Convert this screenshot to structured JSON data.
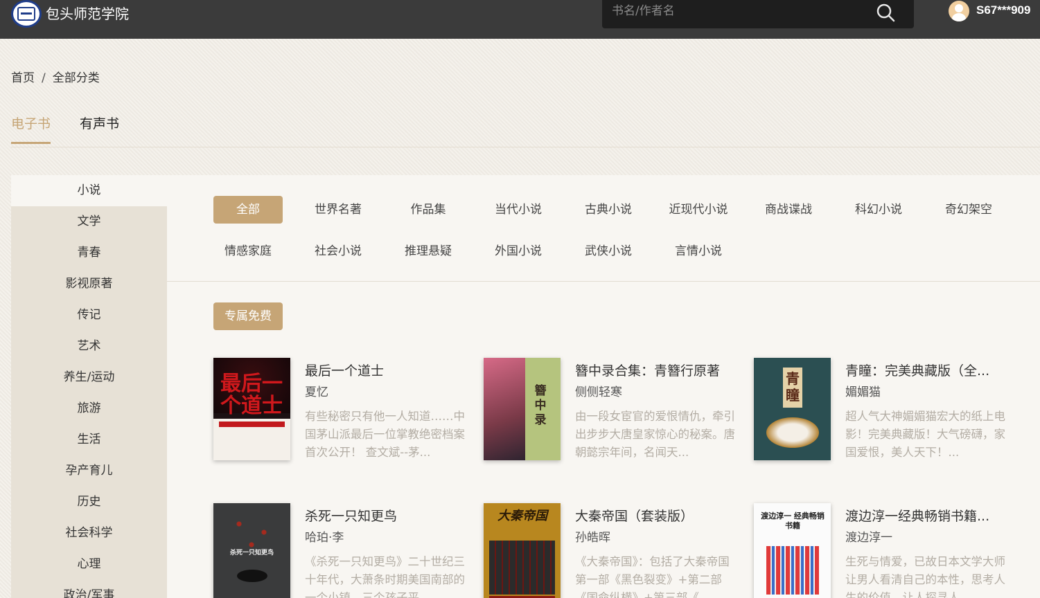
{
  "header": {
    "site_name": "包头师范学院",
    "search_placeholder": "书名/作者名",
    "username": "S67***909"
  },
  "breadcrumb": {
    "home": "首页",
    "separator": "/",
    "current": "全部分类"
  },
  "type_tabs": [
    "电子书",
    "有声书"
  ],
  "sidebar": [
    "小说",
    "文学",
    "青春",
    "影视原著",
    "传记",
    "艺术",
    "养生/运动",
    "旅游",
    "生活",
    "孕产育儿",
    "历史",
    "社会科学",
    "心理",
    "政治/军事"
  ],
  "sub_categories": [
    "全部",
    "世界名著",
    "作品集",
    "当代小说",
    "古典小说",
    "近现代小说",
    "商战谍战",
    "科幻小说",
    "奇幻架空",
    "情感家庭",
    "社会小说",
    "推理悬疑",
    "外国小说",
    "武侠小说",
    "言情小说"
  ],
  "free_button": "专属免费",
  "books": [
    {
      "title": "最后一个道士",
      "author": "夏忆",
      "desc": "有些秘密只有他一人知道……中国茅山派最后一位掌教绝密档案首次公开！ 查文斌--茅...",
      "cover_text": "最后一个道士"
    },
    {
      "title": "簪中录合集：青簪行原著",
      "author": "侧侧轻寒",
      "desc": "由一段女宦官的爱恨情仇，牵引出步步大唐皇家惊心的秘案。唐朝懿宗年间，名闻天...",
      "cover_text": "簪中录"
    },
    {
      "title": "青瞳：完美典藏版（全...",
      "author": "媚媚猫",
      "desc": "超人气大神媚媚猫宏大的纸上电影！完美典藏版！大气磅礴，家国爱恨，美人天下！...",
      "cover_text": "青瞳"
    },
    {
      "title": "杀死一只知更鸟",
      "author": "哈珀·李",
      "desc": "《杀死一只知更鸟》二十世纪三十年代，大萧条时期美国南部的一个小镇，三个孩子平...",
      "cover_text": "杀死一只知更鸟"
    },
    {
      "title": "大秦帝国（套装版）",
      "author": "孙皓晖",
      "desc": "《大秦帝国》：包括了大秦帝国第一部《黑色裂变》+第二部《国命纵横》+第三部《...",
      "cover_text": "大秦帝国"
    },
    {
      "title": "渡边淳一经典畅销书籍...",
      "author": "渡边淳一",
      "desc": "生死与情爱，已故日本文学大师让男人看清自己的本性，思考人生的价值，让人探寻人...",
      "cover_text": "渡边淳一 经典畅销书籍"
    }
  ],
  "colors": {
    "accent": "#c6a576",
    "topbar": "#3b3b3b",
    "background": "#f1ede6"
  }
}
